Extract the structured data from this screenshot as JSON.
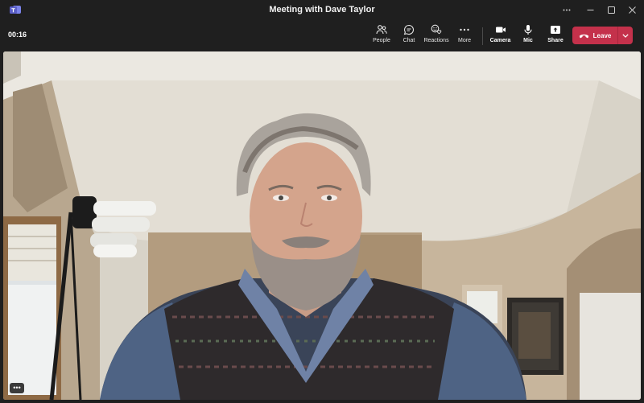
{
  "window": {
    "title": "Meeting with Dave Taylor"
  },
  "toolbar": {
    "timer": "00:16",
    "buttons": [
      {
        "label": "People",
        "icon": "people-icon"
      },
      {
        "label": "Chat",
        "icon": "chat-icon"
      },
      {
        "label": "Reactions",
        "icon": "reactions-icon"
      },
      {
        "label": "More",
        "icon": "more-icon"
      },
      {
        "label": "Camera",
        "icon": "camera-icon"
      },
      {
        "label": "Mic",
        "icon": "mic-icon"
      },
      {
        "label": "Share",
        "icon": "share-icon"
      }
    ],
    "leave_label": "Leave"
  },
  "video": {
    "more_label": "•••"
  },
  "colors": {
    "background": "#1f1f1f",
    "leave": "#c4314b",
    "teams_purple": "#5b5fc7"
  }
}
